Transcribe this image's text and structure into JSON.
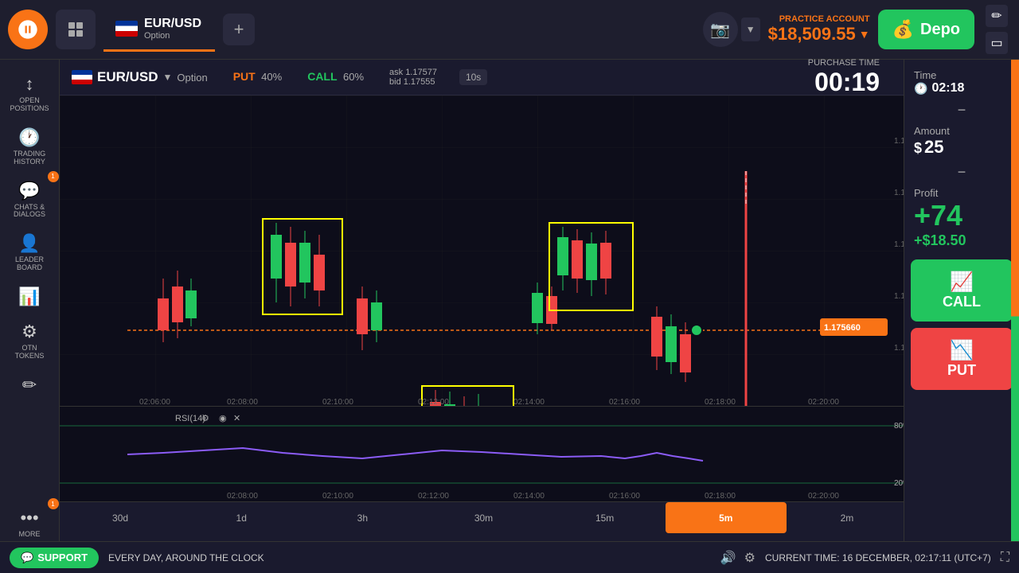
{
  "topbar": {
    "pair": "EUR/USD",
    "pair_sub": "Option",
    "practice_label": "PRACTICE ACCOUNT",
    "balance": "$18,509.55",
    "deposit_label": "Depo",
    "add_label": "+"
  },
  "sidebar": {
    "items": [
      {
        "id": "open-positions",
        "icon": "↕",
        "label": "OPEN\nPOSITIONS",
        "badge": null
      },
      {
        "id": "trading-history",
        "icon": "🕐",
        "label": "TRADING\nHISTORY",
        "badge": null
      },
      {
        "id": "chats",
        "icon": "💬",
        "label": "CHATS &\nDIALOGS",
        "badge": "1"
      },
      {
        "id": "leaderboard",
        "icon": "👤",
        "label": "LEADER\nBOARD",
        "badge": null
      },
      {
        "id": "chart-type",
        "icon": "📊",
        "label": "",
        "badge": null
      },
      {
        "id": "otn",
        "icon": "⚙",
        "label": "OTN\nTOKENS",
        "badge": null
      },
      {
        "id": "draw",
        "icon": "✏",
        "label": "",
        "badge": null
      },
      {
        "id": "more",
        "icon": "···",
        "label": "MORE",
        "badge": "1"
      }
    ]
  },
  "chart": {
    "pair": "EUR/USD",
    "option_label": "Option",
    "purchase_time_label": "PURCHASE TIME",
    "purchase_time": "00:19",
    "put_label": "PUT",
    "put_pct": "40%",
    "call_label": "CALL",
    "call_pct": "60%",
    "ask": "ask 1.17577",
    "bid": "bid 1.17555",
    "price_line": "1.175660",
    "timeframes": [
      "30d",
      "1d",
      "3h",
      "30m",
      "15m",
      "5m",
      "2m"
    ],
    "active_tf": "5m",
    "rsi_label": "RSI(14)",
    "rsi_80": "80%",
    "rsi_20": "20%",
    "times": [
      "02:06:00",
      "02:08:00",
      "02:10:00",
      "02:12:00",
      "02:14:00",
      "02:16:00",
      "02:18:00",
      "02:20:00"
    ],
    "rsi_times": [
      "02:08:00",
      "02:10:00",
      "02:12:00",
      "02:14:00",
      "02:16:00",
      "02:18:00",
      "02:20:00"
    ]
  },
  "right_panel": {
    "time_label": "Time",
    "time_val": "02:18",
    "minus1": "−",
    "amount_label": "Amount",
    "amount_symbol": "$",
    "amount_val": "25",
    "minus2": "−",
    "profit_label": "Profit",
    "profit_val": "+74",
    "profit_dollar": "+$18.50",
    "call_btn": "CALL",
    "put_btn": "PUT"
  },
  "bottom": {
    "support_label": "SUPPORT",
    "ticker": "EVERY DAY, AROUND THE CLOCK",
    "current_time_label": "CURRENT TIME",
    "current_time": "16 DECEMBER, 02:17:11",
    "timezone": "(UTC+7)",
    "fullscreen": "⛶"
  }
}
